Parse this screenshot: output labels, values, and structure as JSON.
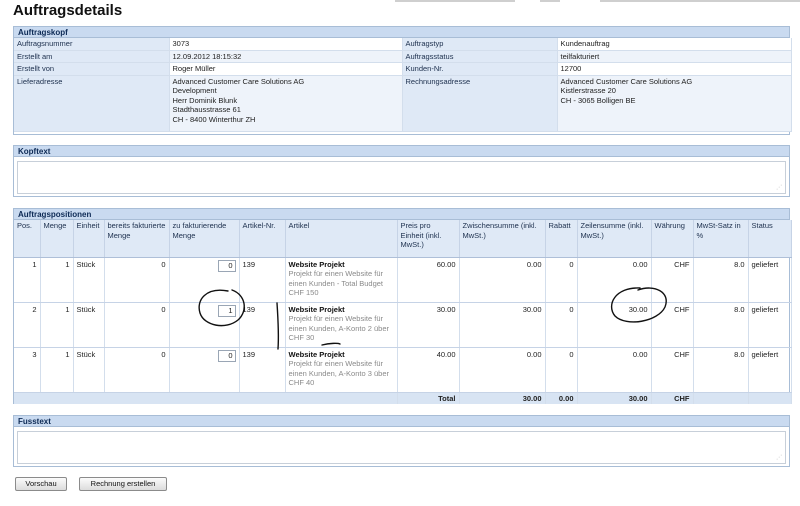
{
  "page": {
    "title": "Auftragsdetails"
  },
  "kopf": {
    "heading": "Auftragskopf",
    "left": [
      {
        "label": "Auftragsnummer",
        "value": "3073"
      },
      {
        "label": "Erstellt am",
        "value": "12.09.2012 18:15:32"
      },
      {
        "label": "Erstellt von",
        "value": "Roger Müller"
      }
    ],
    "right": [
      {
        "label": "Auftragstyp",
        "value": "Kundenauftrag"
      },
      {
        "label": "Auftragsstatus",
        "value": "teilfakturiert"
      },
      {
        "label": "Kunden-Nr.",
        "value": "12700"
      }
    ],
    "lieferadresse_label": "Lieferadresse",
    "lieferadresse": [
      "Advanced Customer Care Solutions AG",
      "Development",
      "Herr Dominik Blunk",
      "Stadthausstrasse 61",
      "CH - 8400 Winterthur ZH"
    ],
    "rechnungsadresse_label": "Rechnungsadresse",
    "rechnungsadresse": [
      "Advanced Customer Care Solutions AG",
      "Kistlerstrasse 20",
      "CH - 3065 Bolligen BE"
    ]
  },
  "kopftext": {
    "heading": "Kopftext",
    "value": ""
  },
  "positionen": {
    "heading": "Auftragspositionen",
    "columns": [
      "Pos.",
      "Menge",
      "Einheit",
      "bereits fakturierte Menge",
      "zu fakturierende Menge",
      "Artikel-Nr.",
      "Artikel",
      "Preis pro Einheit (inkl. MwSt.)",
      "Zwischensumme (inkl. MwSt.)",
      "Rabatt",
      "Zeilensumme (inkl. MwSt.)",
      "Währung",
      "MwSt-Satz in %",
      "Status"
    ],
    "rows": [
      {
        "pos": "1",
        "menge": "1",
        "einheit": "Stück",
        "bereits": "0",
        "zu": "0",
        "artikel_nr": "139",
        "title": "Website Projekt",
        "desc": "Projekt für einen Website für einen Kunden - Total Budget CHF 150",
        "preis": "60.00",
        "zwischensumme": "0.00",
        "rabatt": "0",
        "zeilensumme": "0.00",
        "waehrung": "CHF",
        "mwst": "8.0",
        "status": "geliefert"
      },
      {
        "pos": "2",
        "menge": "1",
        "einheit": "Stück",
        "bereits": "0",
        "zu": "1",
        "artikel_nr": "139",
        "title": "Website Projekt",
        "desc": "Projekt für einen Website für einen Kunden, A-Konto 2 über CHF 30",
        "preis": "30.00",
        "zwischensumme": "30.00",
        "rabatt": "0",
        "zeilensumme": "30.00",
        "waehrung": "CHF",
        "mwst": "8.0",
        "status": "geliefert"
      },
      {
        "pos": "3",
        "menge": "1",
        "einheit": "Stück",
        "bereits": "0",
        "zu": "0",
        "artikel_nr": "139",
        "title": "Website Projekt",
        "desc": "Projekt für einen Website für einen Kunden, A-Konto 3 über CHF 40",
        "preis": "40.00",
        "zwischensumme": "0.00",
        "rabatt": "0",
        "zeilensumme": "0.00",
        "waehrung": "CHF",
        "mwst": "8.0",
        "status": "geliefert"
      }
    ],
    "total": {
      "label": "Total",
      "zwischensumme": "30.00",
      "rabatt": "0.00",
      "zeilensumme": "30.00",
      "waehrung": "CHF"
    }
  },
  "fusstext": {
    "heading": "Fusstext",
    "value": ""
  },
  "buttons": {
    "vorschau": "Vorschau",
    "rechnung_erstellen": "Rechnung erstellen"
  },
  "colors": {
    "panel_header": "#c9daf0",
    "label_bg": "#dfe9f6",
    "border": "#a8bdd6",
    "annotation_ink": "#111111"
  },
  "icons": {
    "resize": "resize-grip-icon"
  }
}
